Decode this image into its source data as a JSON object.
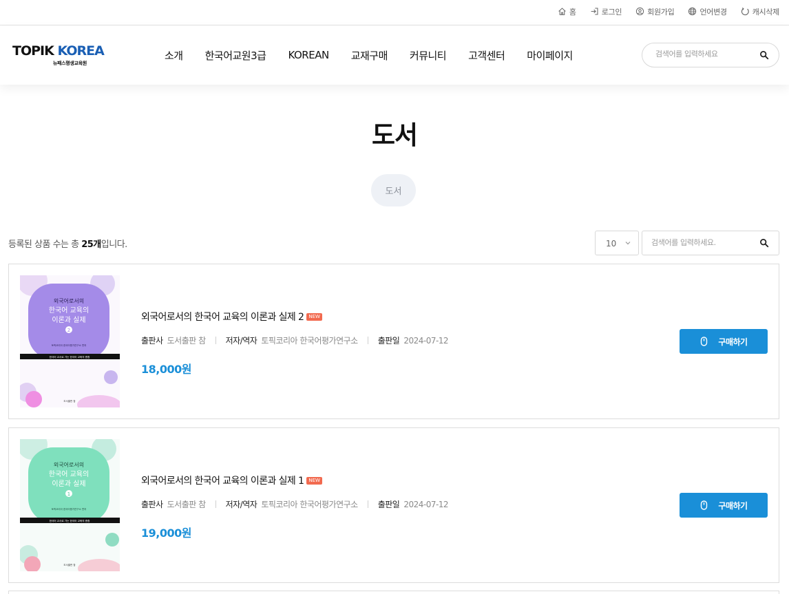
{
  "util": {
    "home": "홈",
    "login": "로그인",
    "signup": "회원가입",
    "language": "언어변경",
    "cache": "캐시삭제"
  },
  "header": {
    "logo_main_1": "TOPIK",
    "logo_main_2": "KOREA",
    "logo_sub": "뉴패스평생교육원",
    "nav": [
      "소개",
      "한국어교원3급",
      "KOREAN",
      "교재구매",
      "커뮤니티",
      "고객센터",
      "마이페이지"
    ],
    "search_placeholder": "검색어를 입력하세요"
  },
  "page": {
    "title": "도서",
    "category": "도서"
  },
  "list": {
    "count_prefix": "등록된 상품 수는 총 ",
    "count_value": "25개",
    "count_suffix": "입니다.",
    "page_size": "10",
    "search_placeholder": "검색어를 입력하세요."
  },
  "products": [
    {
      "title": "외국어로서의 한국어 교육의 이론과 실제 2",
      "badge": "NEW",
      "publisher_label": "출판사",
      "publisher": "도서출판 참",
      "author_label": "저자/역자",
      "author": "토픽코리아 한국어평가연구소",
      "date_label": "출판일",
      "date": "2024-07-12",
      "price": "18,000원",
      "buy_label": "구매하기",
      "cover": {
        "line1": "외국어로서의",
        "line2": "한국어 교육의",
        "line3": "이론과 실제",
        "volume": "2",
        "authors": "토픽코리아 한국어평가연구소 편저",
        "band": "한국어 교사로 가는 한국어 교육의 총합",
        "publisher_mark": "도서출판 참",
        "color": "#a48be8",
        "accent": "#e7a4e6"
      }
    },
    {
      "title": "외국어로서의 한국어 교육의 이론과 실제 1",
      "badge": "NEW",
      "publisher_label": "출판사",
      "publisher": "도서출판 참",
      "author_label": "저자/역자",
      "author": "토픽코리아 한국어평가연구소",
      "date_label": "출판일",
      "date": "2024-07-12",
      "price": "19,000원",
      "buy_label": "구매하기",
      "cover": {
        "line1": "외국어로서의",
        "line2": "한국어 교육의",
        "line3": "이론과 실제",
        "volume": "1",
        "authors": "토픽코리아 한국어평가연구소 편저",
        "band": "한국어 교사로 가는 한국어 교육의 총합",
        "publisher_mark": "도서출판 참",
        "color": "#7fe0bd",
        "accent": "#f3a7b8"
      }
    }
  ],
  "colors": {
    "accent": "#1a8fd8",
    "badge": "#f26a4f",
    "pill_bg": "#eef1f6"
  }
}
